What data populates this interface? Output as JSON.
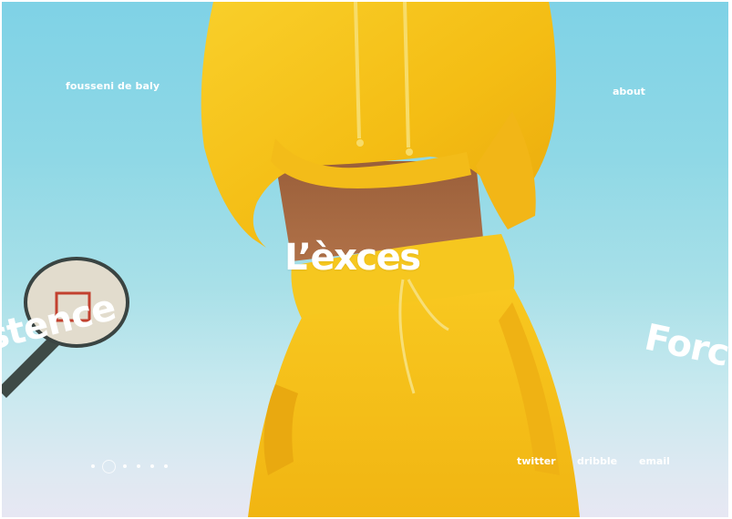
{
  "brand": {
    "name": "fousseni de baly"
  },
  "nav": {
    "about": "about"
  },
  "hero": {
    "headline": "L’èxces",
    "word_left": "istence",
    "word_right": "Forc"
  },
  "pagination": {
    "count": 6,
    "active_index": 1
  },
  "social": {
    "twitter": "twitter",
    "dribbble": "dribble",
    "email": "email"
  },
  "colors": {
    "sky": "#8fd8e6",
    "outfit": "#f6c21c",
    "text": "#ffffff"
  }
}
